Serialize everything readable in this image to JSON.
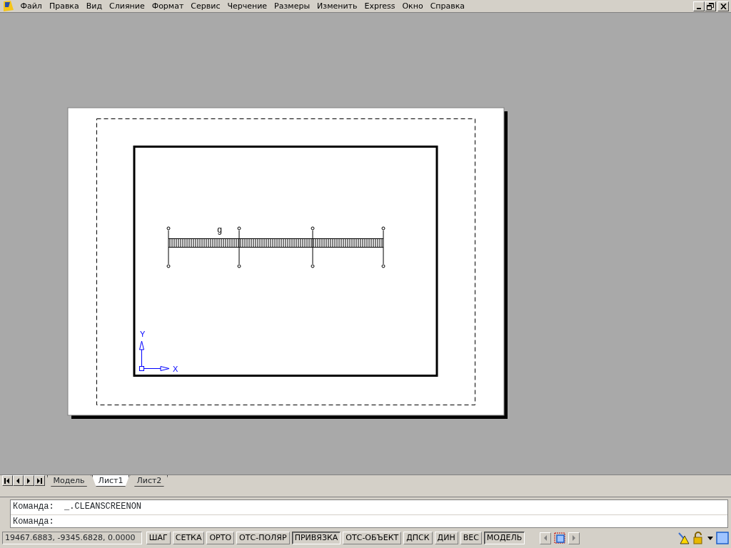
{
  "menu": [
    "Файл",
    "Правка",
    "Вид",
    "Слияние",
    "Формат",
    "Сервис",
    "Черчение",
    "Размеры",
    "Изменить",
    "Express",
    "Окно",
    "Справка"
  ],
  "drawing": {
    "dimension_label": "g",
    "ucs_x": "X",
    "ucs_y": "Y"
  },
  "layout_tabs": [
    {
      "label": "Модель",
      "selected": false
    },
    {
      "label": "Лист1",
      "selected": true
    },
    {
      "label": "Лист2",
      "selected": false
    }
  ],
  "command_history": [
    "Команда:  _.CLEANSCREENON"
  ],
  "command_prompt": "Команда:",
  "status_bar": {
    "coordinates": "19467.6883, -9345.6828, 0.0000",
    "toggles": [
      {
        "label": "ШАГ",
        "on": false
      },
      {
        "label": "СЕТКА",
        "on": false
      },
      {
        "label": "ОРТО",
        "on": false
      },
      {
        "label": "ОТС-ПОЛЯР",
        "on": false
      },
      {
        "label": "ПРИВЯЗКА",
        "on": true
      },
      {
        "label": "ОТС-ОБЪЕКТ",
        "on": false
      },
      {
        "label": "ДПСК",
        "on": false
      },
      {
        "label": "ДИН",
        "on": false
      },
      {
        "label": "ВЕС",
        "on": false
      },
      {
        "label": "МОДЕЛЬ",
        "on": true
      }
    ]
  }
}
